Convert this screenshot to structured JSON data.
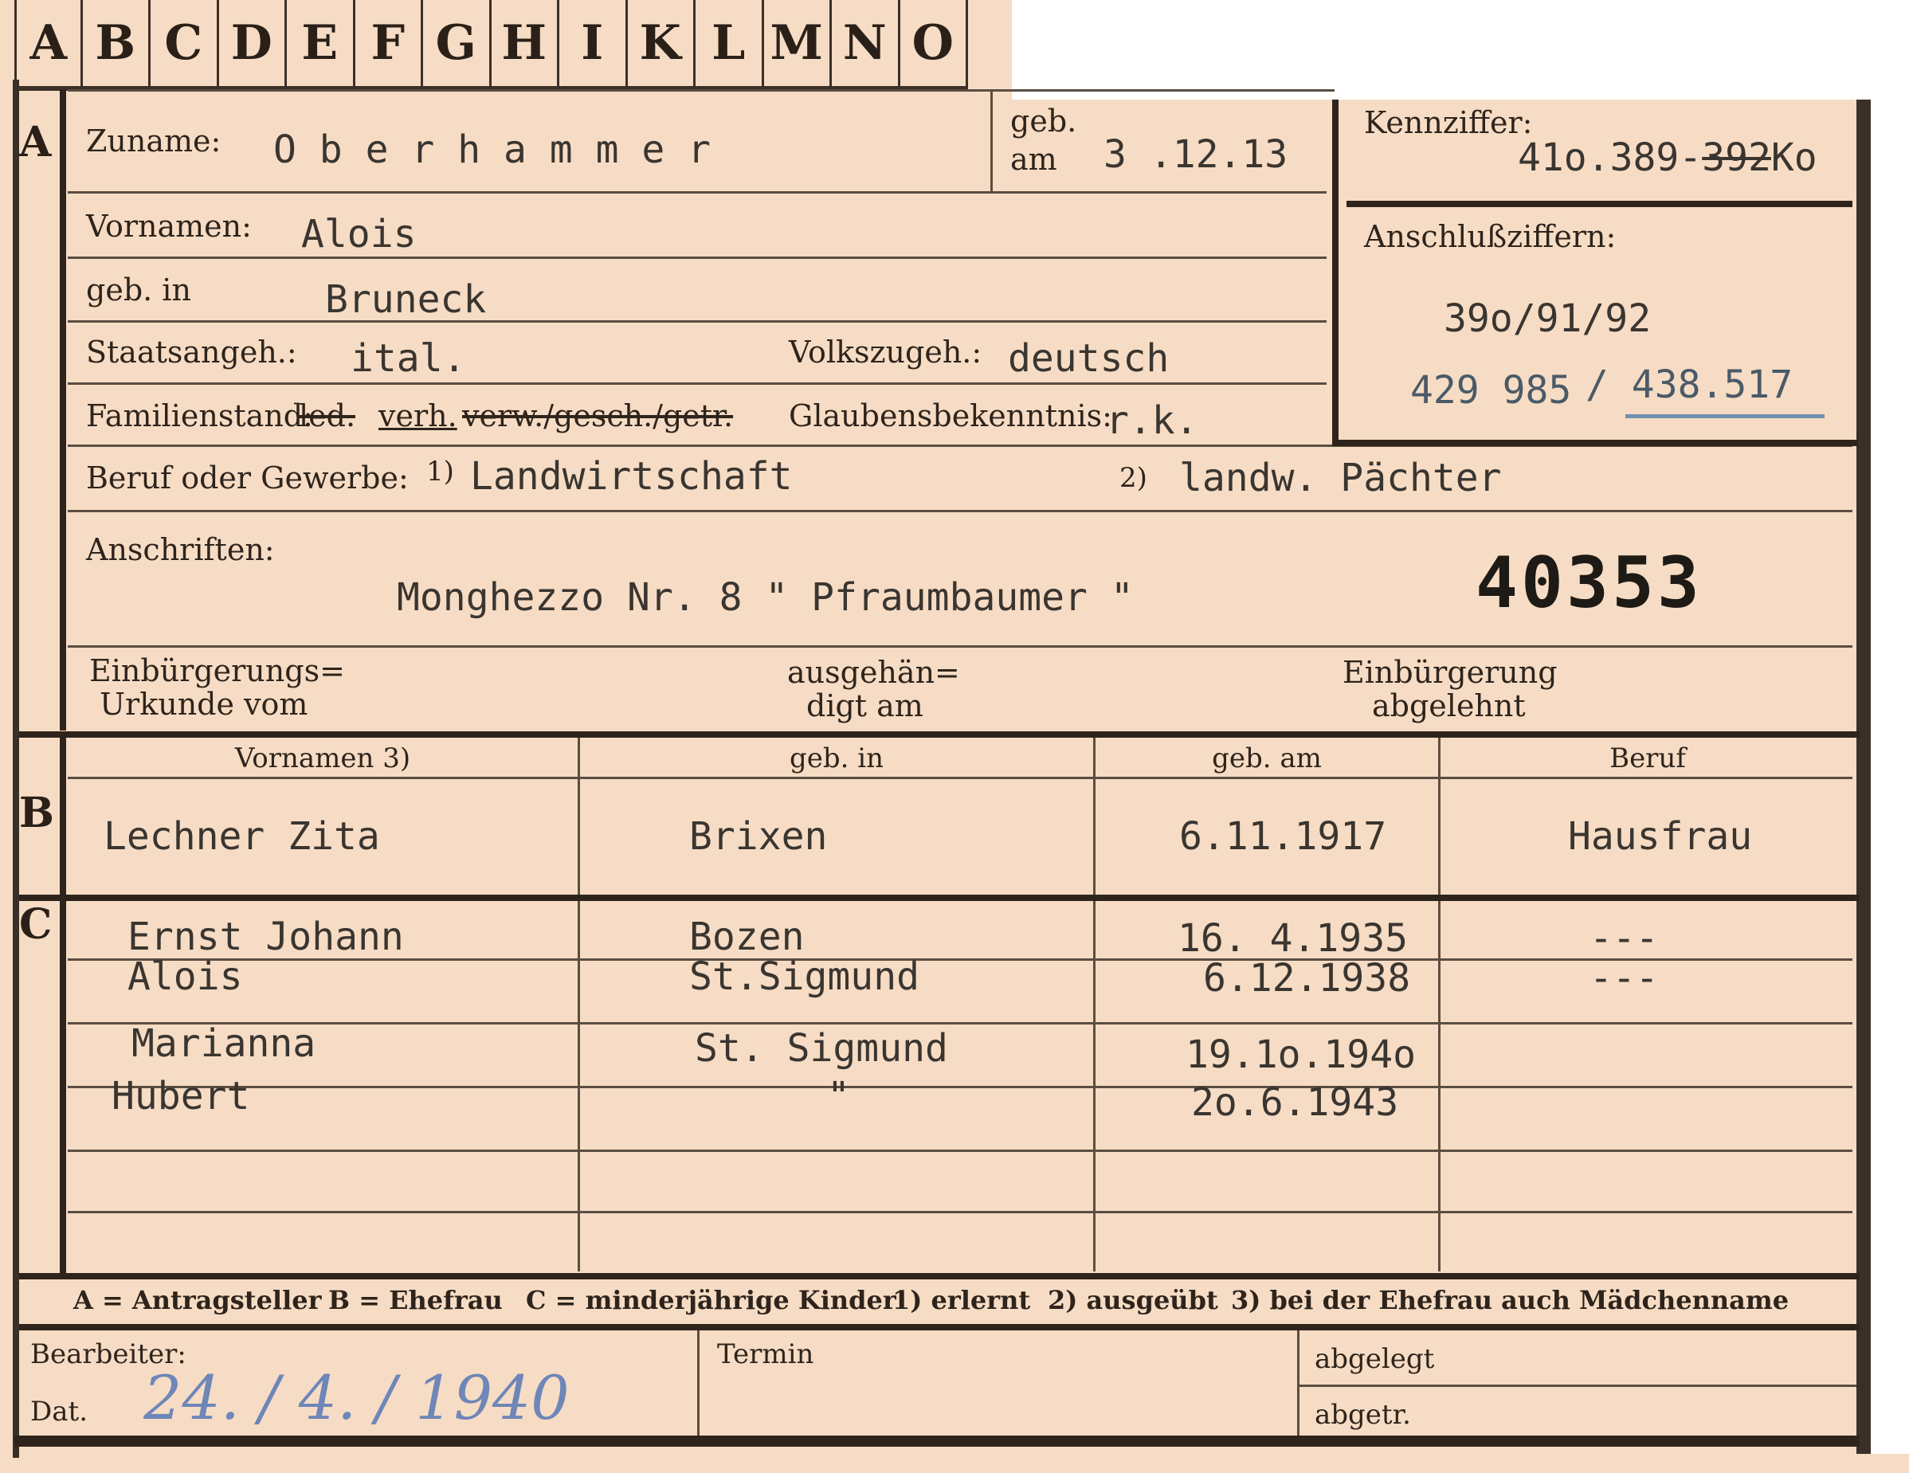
{
  "tabs": [
    "A",
    "B",
    "C",
    "D",
    "E",
    "F",
    "G",
    "H",
    "I",
    "K",
    "L",
    "M",
    "N",
    "O"
  ],
  "sections": {
    "a": "A",
    "b": "B",
    "c": "C"
  },
  "applicant": {
    "surname_label": "Zuname:",
    "surname": "O b e r h a m m e r",
    "born_label_1": "geb.",
    "born_label_2": "am",
    "born_date": "3 .12.13",
    "firstname_label": "Vornamen:",
    "firstname": "Alois",
    "birthplace_label": "geb. in",
    "birthplace": "Bruneck",
    "citizenship_label": "Staatsangeh.:",
    "citizenship": "ital.",
    "ethnicity_label": "Volkszugeh.:",
    "ethnicity": "deutsch",
    "marital_label": "Familienstand:",
    "marital_ledig": "led.",
    "marital_verh": "verh.",
    "marital_rest": "verw./gesch./getr.",
    "religion_label": "Glaubensbekenntnis:",
    "religion": "r.k.",
    "occupation_label": "Beruf oder Gewerbe:",
    "occ1_mark": "1)",
    "occ1": "Landwirtschaft",
    "occ2_mark": "2)",
    "occ2": "landw. Pächter",
    "address_label": "Anschriften:",
    "address": "Monghezzo Nr. 8  \" Pfraumbaumer \"",
    "stamp_number": "40353",
    "naturalization_doc_1": "Einbürgerungs=",
    "naturalization_doc_2": "Urkunde vom",
    "handed_1": "ausgehän=",
    "handed_2": "digt am",
    "rejected_1": "Einbürgerung",
    "rejected_2": "abgelehnt"
  },
  "id_box": {
    "kennziffer_label": "Kennziffer:",
    "kennziffer": "41o.389-",
    "kennziffer_struck": "392",
    "kennziffer_suffix": "Ko",
    "anschluss_label": "Anschlußziffern:",
    "anschluss_1": "39o/91/92",
    "anschluss_2a": "429 985",
    "anschluss_2b": "/ 438.517"
  },
  "table_headers": {
    "vornamen": "Vornamen 3)",
    "geb_in": "geb. in",
    "geb_am": "geb. am",
    "beruf": "Beruf"
  },
  "spouse": {
    "name": "Lechner Zita",
    "birthplace": "Brixen",
    "birthdate": "6.11.1917",
    "occupation": "Hausfrau"
  },
  "children": [
    {
      "name": "Ernst  Johann",
      "birthplace": "Bozen",
      "birthdate": "16. 4.1935",
      "occupation": "---"
    },
    {
      "name": "Alois",
      "birthplace": "St.Sigmund",
      "birthdate": "6.12.1938",
      "occupation": "---"
    },
    {
      "name": "Marianna",
      "birthplace": "St. Sigmund",
      "birthdate": "19.1o.194o",
      "occupation": ""
    },
    {
      "name": "Hubert",
      "birthplace": "\"",
      "birthdate": "2o.6.1943",
      "occupation": ""
    }
  ],
  "legend": {
    "a": "A = Antragsteller",
    "b": "B = Ehefrau",
    "c": "C = minderjährige Kinder",
    "n1": "1) erlernt",
    "n2": "2) ausgeübt",
    "n3": "3) bei der Ehefrau auch Mädchenname"
  },
  "footer": {
    "bearbeiter_label": "Bearbeiter:",
    "dat_label": "Dat.",
    "date_handwritten": "24. / 4. / 1940",
    "termin_label": "Termin",
    "abgelegt_label": "abgelegt",
    "abgetr_label": "abgetr."
  },
  "colors": {
    "card": "#f6dcc4",
    "ink": "#2a2018",
    "handwriting": "#6e86b8",
    "underline": "#6f8fb0"
  }
}
